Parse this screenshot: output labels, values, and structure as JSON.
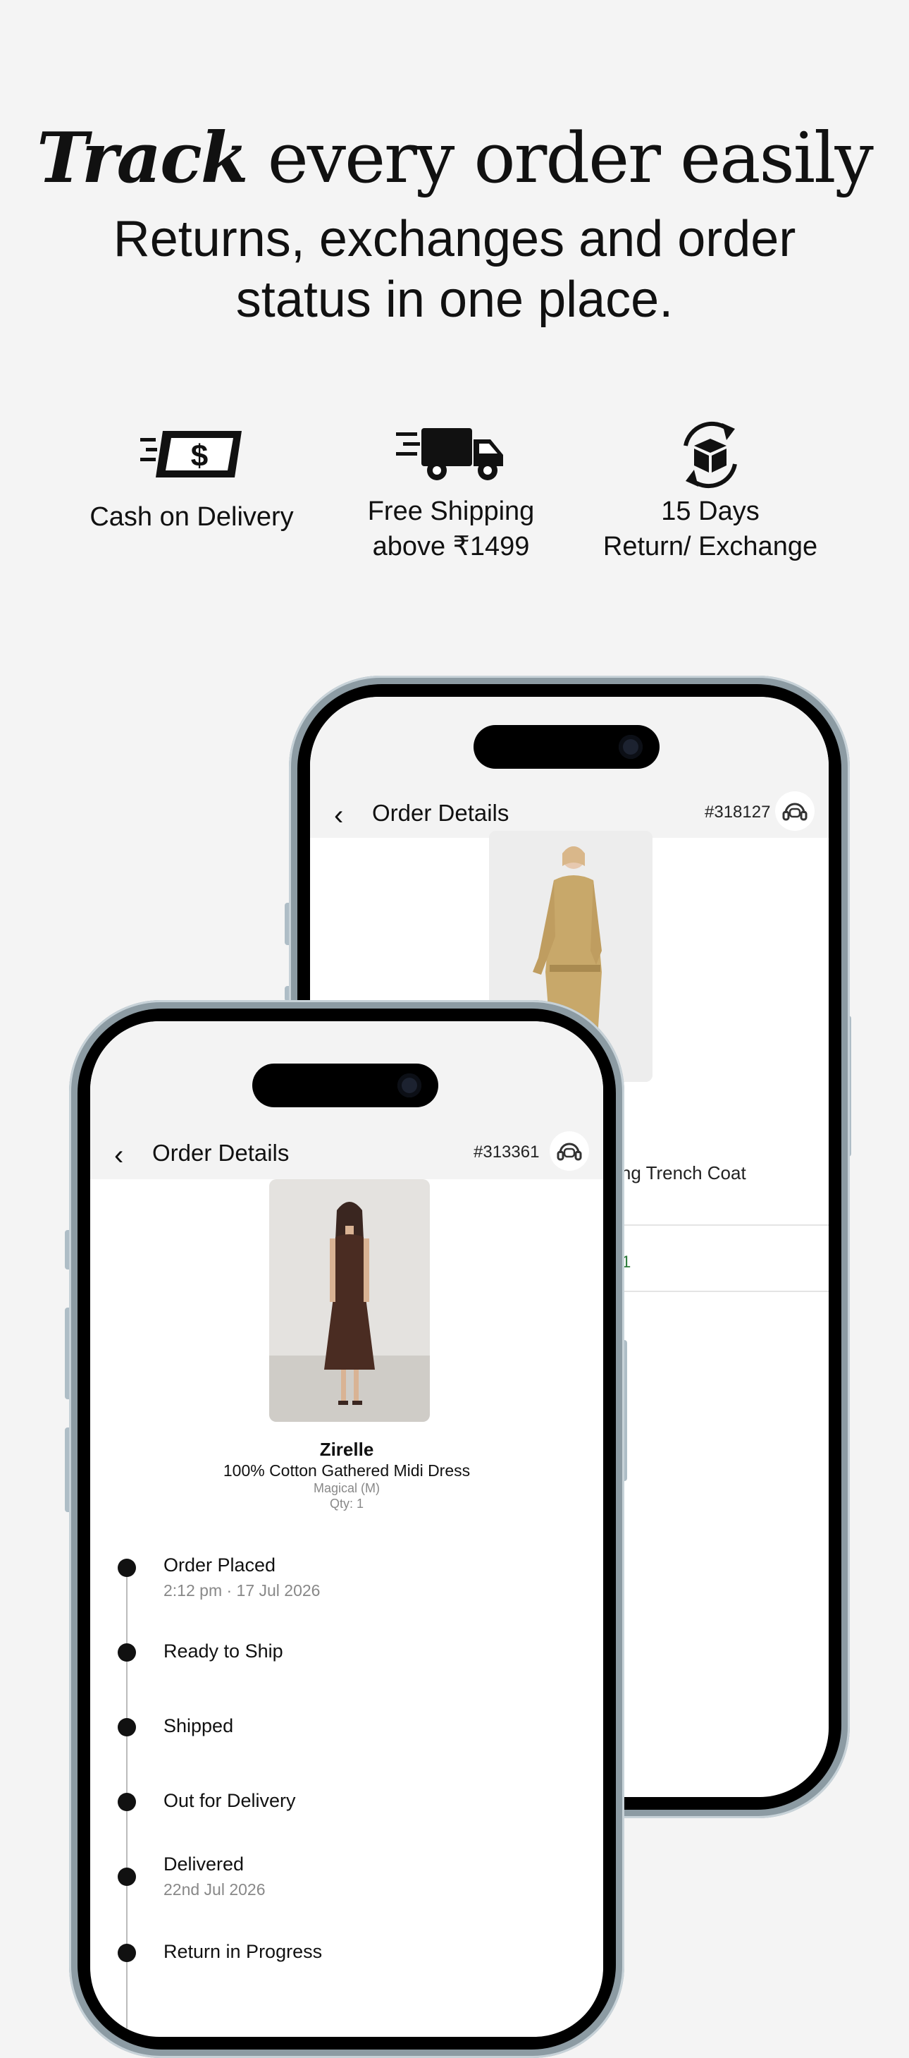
{
  "hero": {
    "headline_em": "Track",
    "headline_rest": " every order easily",
    "subline": "Returns, exchanges and order status in one place."
  },
  "features": [
    {
      "icon": "cash-icon",
      "label": "Cash on Delivery"
    },
    {
      "icon": "delivery-truck-icon",
      "label_line1": "Free Shipping",
      "label_line2": "above ₹1499"
    },
    {
      "icon": "return-exchange-icon",
      "label_line1": "15 Days",
      "label_line2": "Return/ Exchange"
    }
  ],
  "back_phone": {
    "header": {
      "back_icon": "chevron-left-icon",
      "title": "Order Details",
      "order_id": "#318127",
      "help_icon": "headset-icon"
    },
    "product_name_partial": "Long Trench Coat",
    "partial_text": "1"
  },
  "front_phone": {
    "header": {
      "back_icon": "chevron-left-icon",
      "title": "Order Details",
      "order_id": "#313361",
      "help_icon": "headset-icon"
    },
    "product": {
      "brand": "Zirelle",
      "name": "100% Cotton Gathered Midi Dress",
      "variant": "Magical (M)",
      "qty": "Qty: 1"
    },
    "timeline": [
      {
        "label": "Order Placed",
        "detail": "2:12 pm · 17 Jul 2026"
      },
      {
        "label": "Ready to Ship"
      },
      {
        "label": "Shipped"
      },
      {
        "label": "Out for Delivery"
      },
      {
        "label": "Delivered",
        "detail": "22nd Jul 2026"
      },
      {
        "label": "Return in Progress"
      }
    ]
  },
  "colors": {
    "background": "#f4f4f4",
    "phone_frame": "#8c9ba3",
    "dress": "#4a2c22",
    "coat": "#c8a86a"
  }
}
